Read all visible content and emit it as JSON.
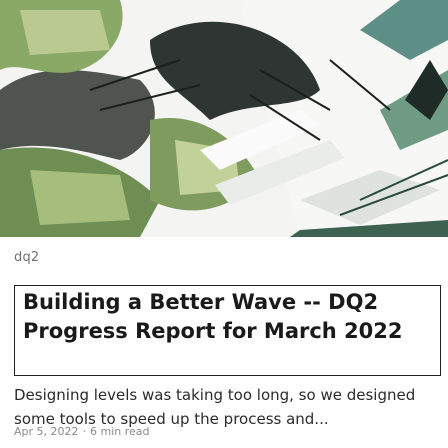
{
  "post": {
    "tag": "dq2",
    "title": "Building a Better Wave -- DQ2 Progress Report for March 2022",
    "excerpt": "Designing levels was taking too long, so we designed some tools to speed up the process and...",
    "date": "Apr 5, 2022",
    "separator": "·",
    "read_time": "6 min read"
  },
  "hero": {
    "icon": "game-level-screenshot"
  }
}
